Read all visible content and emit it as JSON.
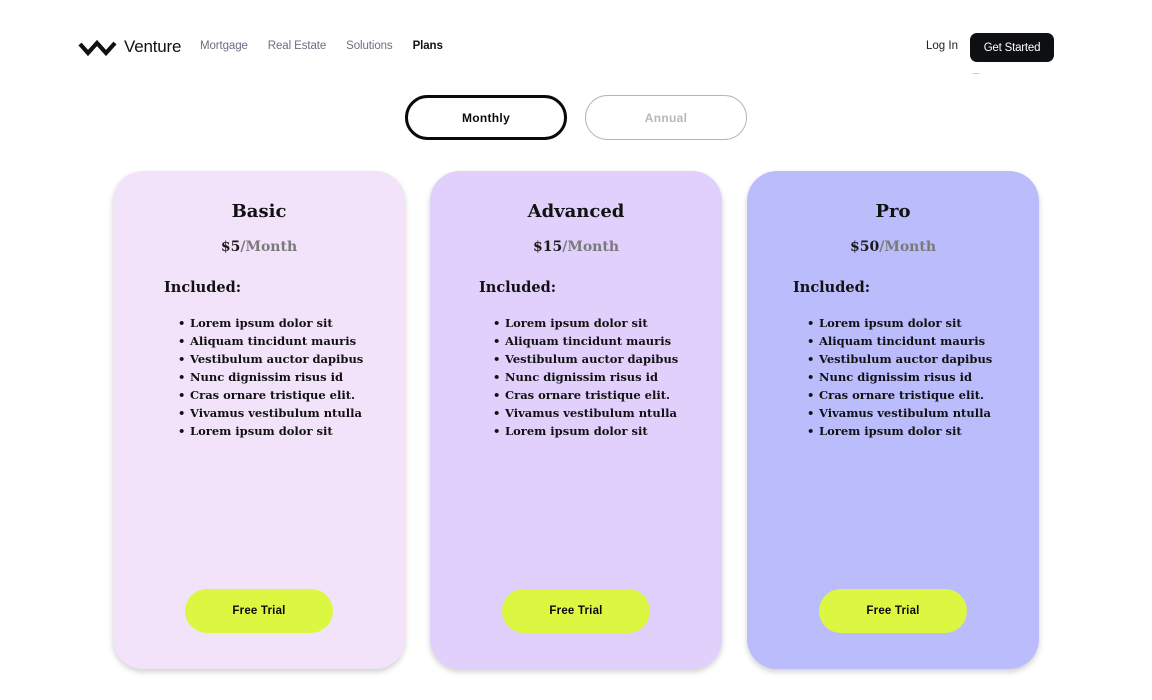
{
  "header": {
    "logo_text": "Venture",
    "nav": [
      {
        "label": "Mortgage"
      },
      {
        "label": "Real Estate"
      },
      {
        "label": "Solutions"
      },
      {
        "label": "Plans"
      }
    ],
    "active_nav": "Plans",
    "login_label": "Log In",
    "cta_label": "Get Started"
  },
  "billing_toggle": {
    "monthly_label": "Monthly",
    "annual_label": "Annual",
    "selected": "Monthly"
  },
  "plans": [
    {
      "name": "Basic",
      "price": "$5",
      "separator": "/",
      "period": "Month",
      "included_label": "Included:",
      "features": [
        "Lorem ipsum dolor sit",
        "Aliquam tincidunt mauris",
        "Vestibulum auctor dapibus",
        "Nunc dignissim risus id",
        "Cras ornare tristique elit.",
        "Vivamus vestibulum ntulla",
        "Lorem ipsum dolor sit"
      ],
      "button_label": "Free Trial",
      "color": "#f3e3fa"
    },
    {
      "name": "Advanced",
      "price": "$15",
      "separator": "/",
      "period": "Month",
      "included_label": "Included:",
      "features": [
        "Lorem ipsum dolor sit",
        "Aliquam tincidunt mauris",
        "Vestibulum auctor dapibus",
        "Nunc dignissim risus id",
        "Cras ornare tristique elit.",
        "Vivamus vestibulum ntulla",
        "Lorem ipsum dolor sit"
      ],
      "button_label": "Free Trial",
      "color": "#e0d0fb"
    },
    {
      "name": "Pro",
      "price": "$50",
      "separator": "/",
      "period": "Month",
      "included_label": "Included:",
      "features": [
        "Lorem ipsum dolor sit",
        "Aliquam tincidunt mauris",
        "Vestibulum auctor dapibus",
        "Nunc dignissim risus id",
        "Cras ornare tristique elit.",
        "Vivamus vestibulum ntulla",
        "Lorem ipsum dolor sit"
      ],
      "button_label": "Free Trial",
      "color": "#babcfc"
    }
  ],
  "colors": {
    "accent_button": "#dcf742",
    "dark": "#0e0f12"
  },
  "icons": {
    "logo": "zigzag-logo-icon"
  }
}
